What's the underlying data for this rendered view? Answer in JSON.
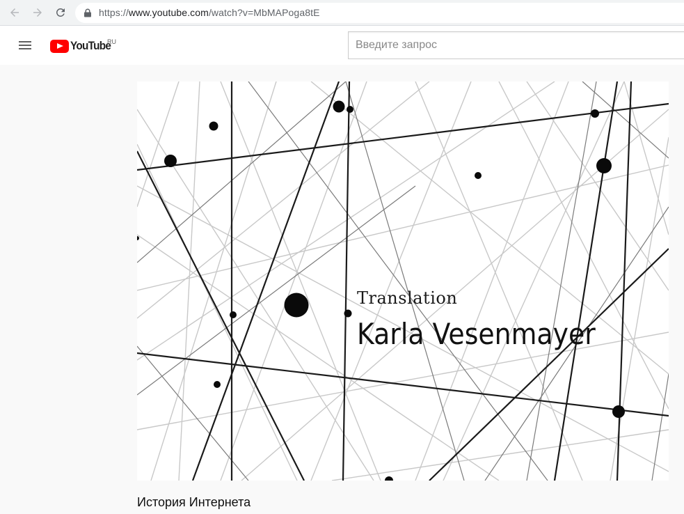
{
  "browser": {
    "back_icon": "arrow-left-icon",
    "forward_icon": "arrow-right-icon",
    "reload_icon": "reload-icon",
    "lock_icon": "lock-icon",
    "url_prefix": "https://",
    "url_main": "www.youtube.com",
    "url_path": "/watch?v=MbMAPoga8tE"
  },
  "header": {
    "menu_icon": "hamburger-menu-icon",
    "logo_text": "YouTube",
    "region": "RU",
    "search_placeholder": "Введите запрос"
  },
  "video": {
    "overlay_small": "Translation",
    "overlay_big": "Karla Vesenmayer",
    "title": "История Интернета"
  },
  "colors": {
    "brand_red": "#ff0000",
    "chrome_bg": "#f1f3f4",
    "page_bg": "#f9f9f9"
  }
}
